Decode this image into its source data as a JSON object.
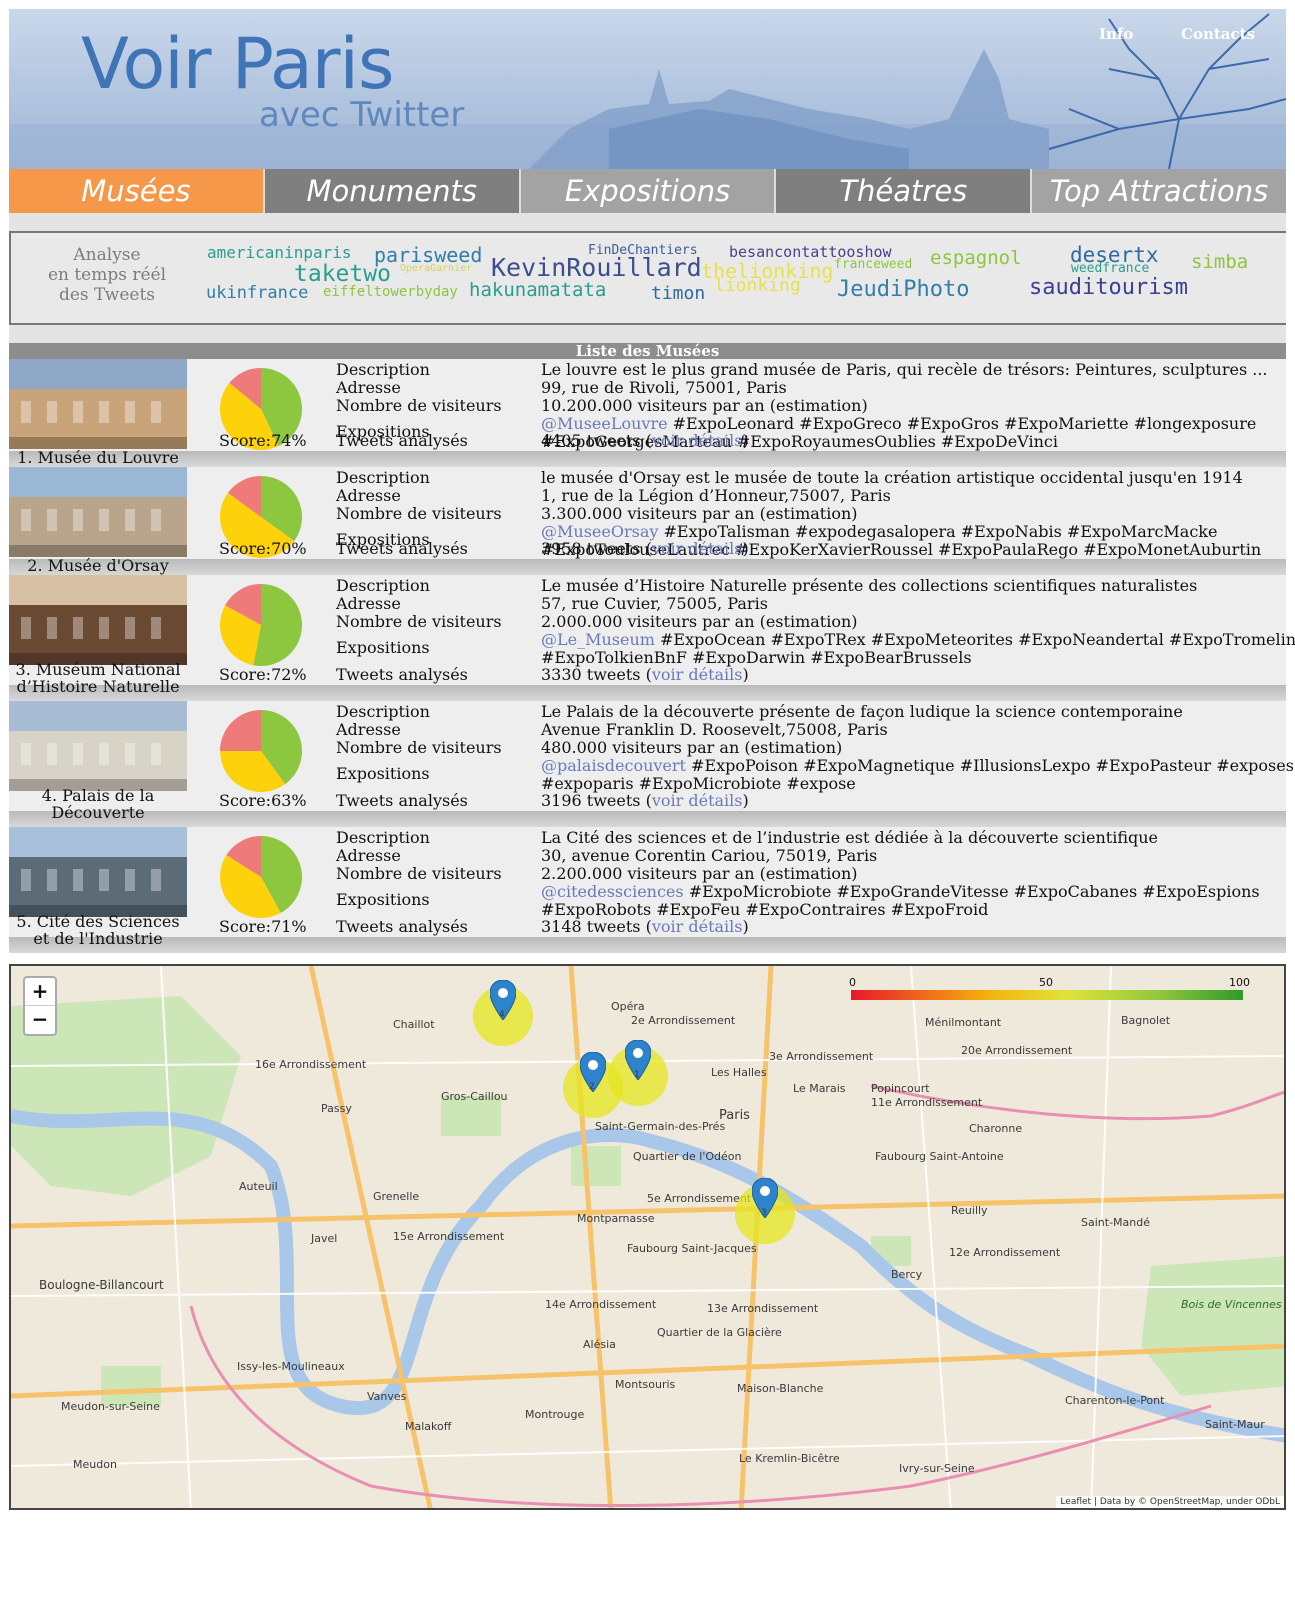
{
  "header": {
    "logo_main": "Voir Paris",
    "logo_sub": "avec Twitter",
    "link_info": "Info",
    "link_contacts": "Contacts"
  },
  "nav": {
    "tabs": [
      {
        "label": "Musées",
        "color": "#f5984a",
        "active": true
      },
      {
        "label": "Monuments",
        "color": "#7f7f7f"
      },
      {
        "label": "Expositions",
        "color": "#a3a3a3"
      },
      {
        "label": "Théatres",
        "color": "#7f7f7f"
      },
      {
        "label": "Top Attractions",
        "color": "#a3a3a3"
      }
    ]
  },
  "cloud": {
    "intro": [
      "Analyse",
      "en temps réél",
      "des Tweets"
    ],
    "words": [
      {
        "text": "americaninparis",
        "color": "#2a9d8f"
      },
      {
        "text": "parisweed",
        "color": "#2f7fa8"
      },
      {
        "text": "FinDeChantiers",
        "color": "#3d5a9c"
      },
      {
        "text": "besancontattooshow",
        "color": "#4a3f8f"
      },
      {
        "text": "espagnol",
        "color": "#8cc63f"
      },
      {
        "text": "desertx",
        "color": "#2c6aa0"
      },
      {
        "text": "simba",
        "color": "#8cc63f"
      },
      {
        "text": "taketwo",
        "color": "#2a9d8f"
      },
      {
        "text": "OperaGarnier",
        "color": "#d8d25a"
      },
      {
        "text": "KevinRouillard",
        "color": "#3b4e8f"
      },
      {
        "text": "thelionking",
        "color": "#e8e24a"
      },
      {
        "text": "franceweed",
        "color": "#8cc63f"
      },
      {
        "text": "weedfrance",
        "color": "#2a9d8f"
      },
      {
        "text": "ukinfrance",
        "color": "#2f7fa8"
      },
      {
        "text": "eiffeltowerbyday",
        "color": "#8cc63f"
      },
      {
        "text": "hakunamatata",
        "color": "#2a9d8f"
      },
      {
        "text": "timon",
        "color": "#2c6aa0"
      },
      {
        "text": "lionking",
        "color": "#e8e24a"
      },
      {
        "text": "JeudiPhoto",
        "color": "#2f7fa8"
      },
      {
        "text": "sauditourism",
        "color": "#3b3f8f"
      }
    ]
  },
  "list_title": "Liste des Musées",
  "labels": {
    "description": "Description",
    "adresse": "Adresse",
    "visiteurs": "Nombre de visiteurs",
    "expositions": "Expositions",
    "tweets": "Tweets analysés",
    "link": "voir détails"
  },
  "museums": [
    {
      "name": "1. Musée du Louvre",
      "score_label": "Score:74%",
      "pie": {
        "positive": 0.43,
        "neutral": 0.43,
        "negative": 0.14
      },
      "description": "Le louvre est le plus grand musée de Paris, qui recèle de trésors: Peintures, sculptures ...",
      "adresse": "99, rue de Rivoli, 75001, Paris",
      "visiteurs": "10.200.000 visiteurs par an (estimation)",
      "handle": "@MuseeLouvre",
      "expo1": " #ExpoLeonard #ExpoGreco #ExpoGros #ExpoMariette #longexposure",
      "expo2": "#ExpoGeorgesMarteau #ExpoRoyaumesOublies #ExpoDeVinci",
      "tweets_pre": "4405 tweets (",
      "tweets_post": ")"
    },
    {
      "name": "2. Musée d'Orsay",
      "score_label": "Score:70%",
      "pie": {
        "positive": 0.35,
        "neutral": 0.5,
        "negative": 0.15
      },
      "description": "le musée d'Orsay est le musée de toute la création artistique occidental jusqu'en 1914",
      "adresse": "1, rue de la Légion d’Honneur,75007, Paris",
      "visiteurs": "3.300.000 visiteurs par an (estimation)",
      "handle": "@MuseeOrsay",
      "expo1": " #ExpoTalisman #expodegasalopera #ExpoNabis #ExpoMarcMacke",
      "expo2": "#ExpoToulouseLautrec #ExpoKerXavierRoussel #ExpoPaulaRego #ExpoMonetAuburtin",
      "tweets_pre": "3958 tweets (",
      "tweets_post": ")"
    },
    {
      "name": "3. Muséum National d’Histoire Naturelle",
      "score_label": "Score:72%",
      "pie": {
        "positive": 0.53,
        "neutral": 0.3,
        "negative": 0.17
      },
      "description": "Le musée d’Histoire Naturelle présente des collections scientifiques naturalistes",
      "adresse": "57, rue Cuvier, 75005, Paris",
      "visiteurs": "2.000.000 visiteurs par an (estimation)",
      "handle": "@Le_Museum",
      "expo1": " #ExpoOcean #ExpoTRex #ExpoMeteorites #ExpoNeandertal #ExpoTromelin",
      "expo2": "#ExpoTolkienBnF #ExpoDarwin #ExpoBearBrussels",
      "tweets_pre": "3330 tweets (",
      "tweets_post": ")"
    },
    {
      "name": "4. Palais de la Découverte",
      "score_label": "Score:63%",
      "pie": {
        "positive": 0.4,
        "neutral": 0.35,
        "negative": 0.25
      },
      "description": "Le Palais de la découverte présente de façon ludique la science contemporaine",
      "adresse": "Avenue Franklin D. Roosevelt,75008, Paris",
      "visiteurs": "480.000 visiteurs par an (estimation)",
      "handle": "@palaisdecouvert",
      "expo1": " #ExpoPoison #ExpoMagnetique #IllusionsLexpo #ExpoPasteur #exposes",
      "expo2": "#expoparis #ExpoMicrobiote #expose",
      "tweets_pre": "3196 tweets (",
      "tweets_post": ")"
    },
    {
      "name": "5. Cité des Sciences et de l'Industrie",
      "score_label": "Score:71%",
      "pie": {
        "positive": 0.42,
        "neutral": 0.42,
        "negative": 0.16
      },
      "description": "La Cité des sciences et de l’industrie est dédiée à la découverte scientifique",
      "adresse": "30, avenue Corentin Cariou, 75019, Paris",
      "visiteurs": "2.200.000 visiteurs par an (estimation)",
      "handle": "@citedessciences",
      "expo1": " #ExpoMicrobiote #ExpoGrandeVitesse #ExpoCabanes #ExpoEspions",
      "expo2": "#ExpoRobots #ExpoFeu #ExpoContraires #ExpoFroid",
      "tweets_pre": "3148 tweets (",
      "tweets_post": ")"
    }
  ],
  "pie_colors": {
    "positive": "#8dc63f",
    "neutral": "#fdd20b",
    "negative": "#ef7a7a"
  },
  "map": {
    "zoom_in": "+",
    "zoom_out": "−",
    "legend": [
      "0",
      "50",
      "100"
    ],
    "markers": [
      "4",
      "2",
      "1",
      "3"
    ],
    "places": [
      "Opéra",
      "2e Arrondissement",
      "Chaillot",
      "16e Arrondissement",
      "Gros-Caillou",
      "Passy",
      "Paris",
      "Saint-Germain-des-Prés",
      "Quartier de l'Odéon",
      "5e Arrondissement",
      "Le Marais",
      "3e Arrondissement",
      "Popincourt",
      "11e Arrondissement",
      "20e Arrondissement",
      "Ménilmontant",
      "Bagnolet",
      "Charonne",
      "Auteuil",
      "Grenelle",
      "Javel",
      "15e Arrondissement",
      "Montparnasse",
      "Faubourg Saint-Jacques",
      "Reuilly",
      "Saint-Mandé",
      "12e Arrondissement",
      "Bercy",
      "Boulogne-Billancourt",
      "14e Arrondissement",
      "13e Arrondissement",
      "Alésia",
      "Quartier de la Glacière",
      "Issy-les-Moulineaux",
      "Vanves",
      "Malakoff",
      "Montrouge",
      "Montsouris",
      "Maison-Blanche",
      "Meudon-sur-Seine",
      "Meudon",
      "Le Kremlin-Bicêtre",
      "Ivry-sur-Seine",
      "Charenton-le-Pont",
      "Faubourg Saint-Antoine",
      "Les Halles",
      "Bois de Vincennes",
      "Saint-Maur"
    ],
    "attribution": "Leaflet | Data by © OpenStreetMap, under ODbL"
  }
}
